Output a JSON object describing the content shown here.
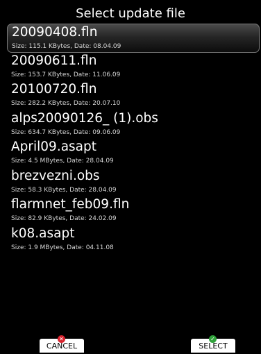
{
  "header": {
    "title": "Select update file"
  },
  "files": [
    {
      "name": "20090408.fln",
      "info": "Size: 115.1 KBytes, Date: 08.04.09",
      "selected": true
    },
    {
      "name": "20090611.fln",
      "info": "Size: 153.7 KBytes, Date: 11.06.09"
    },
    {
      "name": "20100720.fln",
      "info": "Size: 282.2 KBytes, Date: 20.07.10"
    },
    {
      "name": "alps20090126_ (1).obs",
      "info": "Size: 634.7 KBytes, Date: 09.06.09"
    },
    {
      "name": "April09.asapt",
      "info": "Size: 4.5 MBytes, Date: 28.04.09"
    },
    {
      "name": "brezvezni.obs",
      "info": "Size: 58.3 KBytes, Date: 28.04.09"
    },
    {
      "name": "flarmnet_feb09.fln",
      "info": "Size: 82.9 KBytes, Date: 24.02.09"
    },
    {
      "name": "k08.asapt",
      "info": "Size: 1.9 MBytes, Date: 04.11.08"
    }
  ],
  "buttons": {
    "cancel": {
      "label": "CANCEL",
      "icon": "x-icon",
      "color": "#d9232e"
    },
    "select": {
      "label": "SELECT",
      "icon": "check-icon",
      "color": "#2fa23a"
    }
  }
}
